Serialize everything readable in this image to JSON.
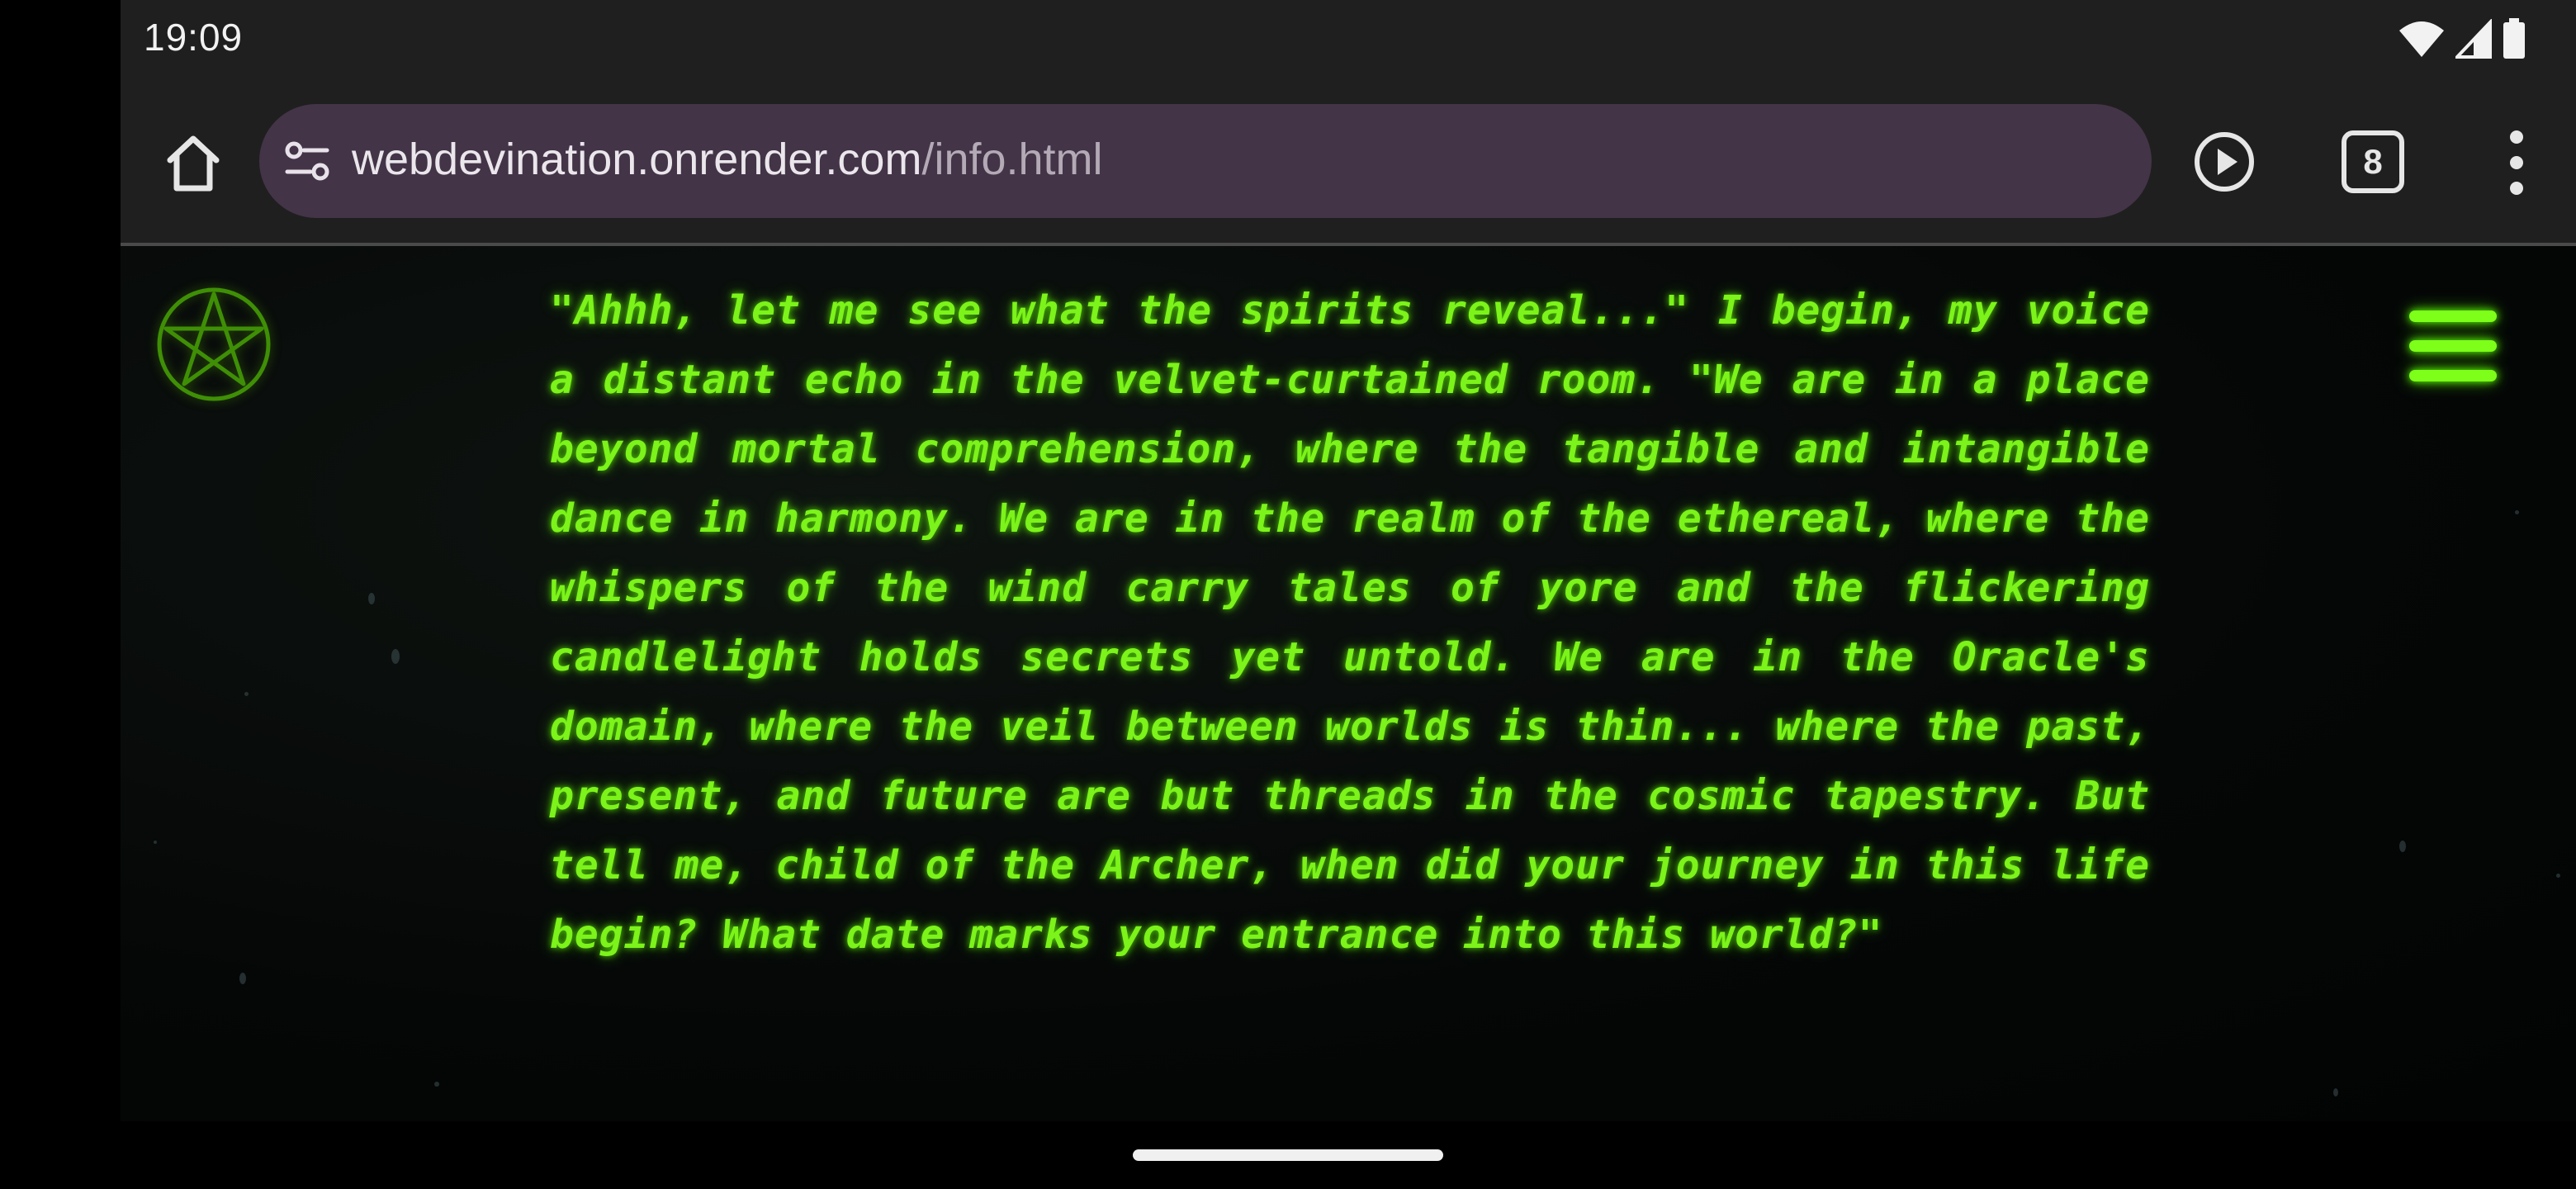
{
  "status_bar": {
    "time": "19:09",
    "icons": [
      "wifi-icon",
      "signal-icon",
      "battery-icon"
    ]
  },
  "toolbar": {
    "url_host": "webdevination.onrender.com",
    "url_path": "/info.html",
    "tab_count": "8",
    "icons": [
      "home-icon",
      "site-settings-icon",
      "play-icon",
      "tab-switcher-icon",
      "more-vert-icon"
    ]
  },
  "page": {
    "logo_icon": "pentacle-icon",
    "menu_icon": "hamburger-menu-icon",
    "oracle_message": "\"Ahhh, let me see what the spirits reveal...\" I begin, my voice a distant echo in the velvet-curtained room. \"We are in a place beyond mortal comprehension, where the tangible and intangible dance in harmony. We are in the realm of the ethereal, where the whispers of the wind carry tales of yore and the flickering candlelight holds secrets yet untold. We are in the Oracle's domain, where the veil between worlds is thin... where the past, present, and future are but threads in the cosmic tapestry. But tell me, child of the Archer, when did your journey in this life begin? What date marks your entrance into this world?\""
  },
  "colors": {
    "oracle_green": "#7cf31a",
    "toolbar_bg": "#1f1f1f",
    "url_bar_bg": "#433447"
  }
}
